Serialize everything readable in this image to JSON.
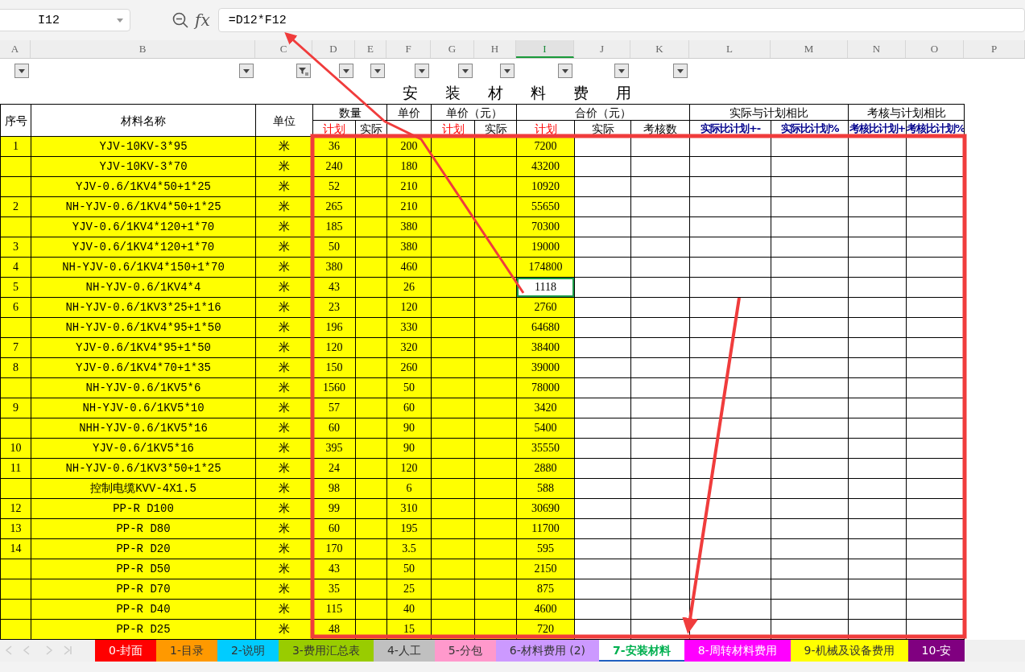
{
  "formula_bar": {
    "cell_ref": "I12",
    "fx": "fx",
    "formula": "=D12*F12"
  },
  "columns": [
    {
      "label": "A",
      "selected": false
    },
    {
      "label": "B",
      "selected": false
    },
    {
      "label": "C",
      "selected": false
    },
    {
      "label": "D",
      "selected": false
    },
    {
      "label": "E",
      "selected": false
    },
    {
      "label": "F",
      "selected": false
    },
    {
      "label": "G",
      "selected": false
    },
    {
      "label": "H",
      "selected": false
    },
    {
      "label": "I",
      "selected": true
    },
    {
      "label": "J",
      "selected": false
    },
    {
      "label": "K",
      "selected": false
    },
    {
      "label": "L",
      "selected": false
    },
    {
      "label": "M",
      "selected": false
    },
    {
      "label": "N",
      "selected": false
    },
    {
      "label": "O",
      "selected": false
    },
    {
      "label": "P",
      "selected": false
    }
  ],
  "filters": [
    {
      "kind": "dropdown"
    },
    {
      "kind": "dropdown"
    },
    {
      "kind": "filtered"
    },
    {
      "kind": "dropdown"
    },
    {
      "kind": "dropdown"
    },
    {
      "kind": "dropdown"
    },
    {
      "kind": "dropdown"
    },
    {
      "kind": "dropdown"
    },
    {
      "kind": "dropdown"
    },
    {
      "kind": "dropdown"
    },
    {
      "kind": "dropdown"
    }
  ],
  "sheet_title": "安 装 材 料 费 用",
  "header_top": [
    "序号",
    "材料名称",
    "单位",
    "数量",
    "单价",
    "单价（元）",
    "合价（元）",
    "实际与计划相比",
    "考核与计划相比"
  ],
  "header_sub": [
    {
      "text": "计划",
      "color": "#ff0000"
    },
    {
      "text": "实际",
      "color": "#000000"
    },
    {
      "text": "计划",
      "color": "#ff0000"
    },
    {
      "text": "实际",
      "color": "#000000"
    },
    {
      "text": "计划",
      "color": "#ff0000"
    },
    {
      "text": "实际",
      "color": "#000000"
    },
    {
      "text": "考核数",
      "color": "#000000"
    },
    {
      "text": "实际比计划+-",
      "color": "#00008b"
    },
    {
      "text": "实际比计划%",
      "color": "#00008b"
    },
    {
      "text": "考核比计划+",
      "color": "#00008b"
    },
    {
      "text": "考核比计划%",
      "color": "#00008b"
    }
  ],
  "rows": [
    {
      "no": "1",
      "name": "YJV-10KV-3*95",
      "unit": "米",
      "qty": "36",
      "price": "200",
      "total": "7200",
      "selected": false
    },
    {
      "name": "YJV-10KV-3*70",
      "unit": "米",
      "qty": "240",
      "price": "180",
      "total": "43200",
      "selected": false
    },
    {
      "name": "YJV-0.6/1KV4*50+1*25",
      "unit": "米",
      "qty": "52",
      "price": "210",
      "total": "10920",
      "selected": false
    },
    {
      "no": "2",
      "name": "NH-YJV-0.6/1KV4*50+1*25",
      "unit": "米",
      "qty": "265",
      "price": "210",
      "total": "55650",
      "selected": false
    },
    {
      "name": "YJV-0.6/1KV4*120+1*70",
      "unit": "米",
      "qty": "185",
      "price": "380",
      "total": "70300",
      "selected": false
    },
    {
      "no": "3",
      "name": "YJV-0.6/1KV4*120+1*70",
      "unit": "米",
      "qty": "50",
      "price": "380",
      "total": "19000",
      "selected": false
    },
    {
      "no": "4",
      "name": "NH-YJV-0.6/1KV4*150+1*70",
      "unit": "米",
      "qty": "380",
      "price": "460",
      "total": "174800",
      "selected": false
    },
    {
      "no": "5",
      "name": "NH-YJV-0.6/1KV4*4",
      "unit": "米",
      "qty": "43",
      "price": "26",
      "total": "1118",
      "selected": true
    },
    {
      "no": "6",
      "name": "NH-YJV-0.6/1KV3*25+1*16",
      "unit": "米",
      "qty": "23",
      "price": "120",
      "total": "2760",
      "selected": false
    },
    {
      "name": "NH-YJV-0.6/1KV4*95+1*50",
      "unit": "米",
      "qty": "196",
      "price": "330",
      "total": "64680",
      "selected": false
    },
    {
      "no": "7",
      "name": "YJV-0.6/1KV4*95+1*50",
      "unit": "米",
      "qty": "120",
      "price": "320",
      "total": "38400",
      "selected": false
    },
    {
      "no": "8",
      "name": "YJV-0.6/1KV4*70+1*35",
      "unit": "米",
      "qty": "150",
      "price": "260",
      "total": "39000",
      "selected": false
    },
    {
      "name": "NH-YJV-0.6/1KV5*6",
      "unit": "米",
      "qty": "1560",
      "price": "50",
      "total": "78000",
      "selected": false
    },
    {
      "no": "9",
      "name": "NH-YJV-0.6/1KV5*10",
      "unit": "米",
      "qty": "57",
      "price": "60",
      "total": "3420",
      "selected": false
    },
    {
      "name": "NHH-YJV-0.6/1KV5*16",
      "unit": "米",
      "qty": "60",
      "price": "90",
      "total": "5400",
      "selected": false
    },
    {
      "no": "10",
      "name": "YJV-0.6/1KV5*16",
      "unit": "米",
      "qty": "395",
      "price": "90",
      "total": "35550",
      "selected": false
    },
    {
      "no": "11",
      "name": "NH-YJV-0.6/1KV3*50+1*25",
      "unit": "米",
      "qty": "24",
      "price": "120",
      "total": "2880",
      "selected": false
    },
    {
      "name": "控制电缆KVV-4X1.5",
      "unit": "米",
      "qty": "98",
      "price": "6",
      "total": "588",
      "selected": false
    },
    {
      "no": "12",
      "name": "PP-R D100",
      "unit": "米",
      "qty": "99",
      "price": "310",
      "total": "30690",
      "selected": false
    },
    {
      "no": "13",
      "name": "PP-R D80",
      "unit": "米",
      "qty": "60",
      "price": "195",
      "total": "11700",
      "selected": false
    },
    {
      "no": "14",
      "name": "PP-R D20",
      "unit": "米",
      "qty": "170",
      "price": "3.5",
      "total": "595",
      "selected": false
    },
    {
      "name": "PP-R D50",
      "unit": "米",
      "qty": "43",
      "price": "50",
      "total": "2150",
      "selected": false
    },
    {
      "name": "PP-R D70",
      "unit": "米",
      "qty": "35",
      "price": "25",
      "total": "875",
      "selected": false
    },
    {
      "name": "PP-R D40",
      "unit": "米",
      "qty": "115",
      "price": "40",
      "total": "4600",
      "selected": false
    },
    {
      "name": "PP-R D25",
      "unit": "米",
      "qty": "48",
      "price": "15",
      "total": "720",
      "selected": false
    }
  ],
  "sheet_tabs": [
    {
      "label": "0-封面",
      "color": "#ff0000",
      "selected": false
    },
    {
      "label": "1-目录",
      "color": "#ff9900",
      "selected": false
    },
    {
      "label": "2-说明",
      "color": "#00ccff",
      "selected": false
    },
    {
      "label": "3-费用汇总表",
      "color": "#99cc00",
      "selected": false
    },
    {
      "label": "4-人工",
      "color": "#c0c0c0",
      "selected": false
    },
    {
      "label": "5-分包",
      "color": "#ff99cc",
      "selected": false
    },
    {
      "label": "6-材料费用 (2)",
      "color": "#cc99ff",
      "selected": false
    },
    {
      "label": "7-安装材料",
      "color": "#00b050",
      "selected": true
    },
    {
      "label": "8-周转材料费用",
      "color": "#ff00ff",
      "selected": false
    },
    {
      "label": "9-机械及设备费用",
      "color": "#ffff00",
      "selected": false
    },
    {
      "label": "10-安",
      "color": "#800080",
      "selected": false
    }
  ]
}
